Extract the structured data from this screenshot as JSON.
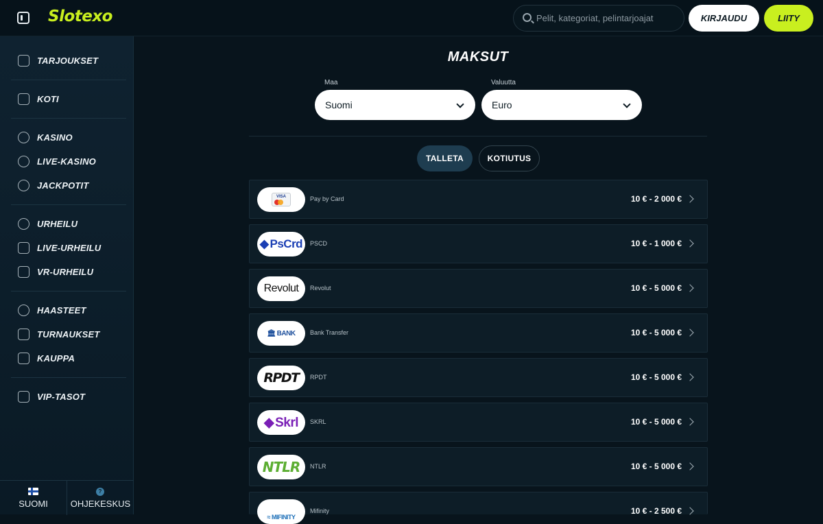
{
  "header": {
    "logo_text": "Slotexo",
    "search_placeholder": "Pelit, kategoriat, pelintarjoajat",
    "login_label": "KIRJAUDU",
    "join_label": "LIITY"
  },
  "sidebar": {
    "items": [
      {
        "label": "TARJOUKSET",
        "icon": "gift-store-icon"
      },
      {
        "label": "KOTI",
        "icon": "home-icon"
      },
      {
        "label": "KASINO",
        "icon": "roulette-icon"
      },
      {
        "label": "LIVE-KASINO",
        "icon": "spade-icon"
      },
      {
        "label": "JACKPOTIT",
        "icon": "seven-icon"
      },
      {
        "label": "URHEILU",
        "icon": "football-icon"
      },
      {
        "label": "LIVE-URHEILU",
        "icon": "play-screen-icon"
      },
      {
        "label": "VR-URHEILU",
        "icon": "gamepad-icon"
      },
      {
        "label": "HAASTEET",
        "icon": "lightbulb-icon"
      },
      {
        "label": "TURNAUKSET",
        "icon": "trophy-icon"
      },
      {
        "label": "KAUPPA",
        "icon": "shop-icon"
      },
      {
        "label": "VIP-TASOT",
        "icon": "diamond-icon"
      }
    ],
    "language_label": "SUOMI",
    "help_label": "OHJEKESKUS",
    "help_glyph": "?"
  },
  "main": {
    "title": "MAKSUT",
    "country_label": "Maa",
    "country_value": "Suomi",
    "currency_label": "Valuutta",
    "currency_value": "Euro",
    "tabs": [
      {
        "label": "TALLETA",
        "active": true
      },
      {
        "label": "KOTIUTUS",
        "active": false
      }
    ],
    "methods": [
      {
        "name": "Pay by Card",
        "range": "10 € - 2 000 €",
        "logo": "VISA"
      },
      {
        "name": "PSCD",
        "range": "10 € - 1 000 €",
        "logo": "PsCrd"
      },
      {
        "name": "Revolut",
        "range": "10 € - 5 000 €",
        "logo": "Revolut"
      },
      {
        "name": "Bank Transfer",
        "range": "10 € - 5 000 €",
        "logo": "BANK"
      },
      {
        "name": "RPDT",
        "range": "10 € - 5 000 €",
        "logo": "RPDT"
      },
      {
        "name": "SKRL",
        "range": "10 € - 5 000 €",
        "logo": "Skrl"
      },
      {
        "name": "NTLR",
        "range": "10 € - 5 000 €",
        "logo": "NTLR"
      },
      {
        "name": "Mifinity",
        "range": "10 € - 2 500 €",
        "logo": "MIFINITY"
      }
    ]
  },
  "colors": {
    "accent": "#c9ef1f",
    "background": "#08141c",
    "sidebar": "#0f2230",
    "active_tab": "#1e3d50"
  }
}
